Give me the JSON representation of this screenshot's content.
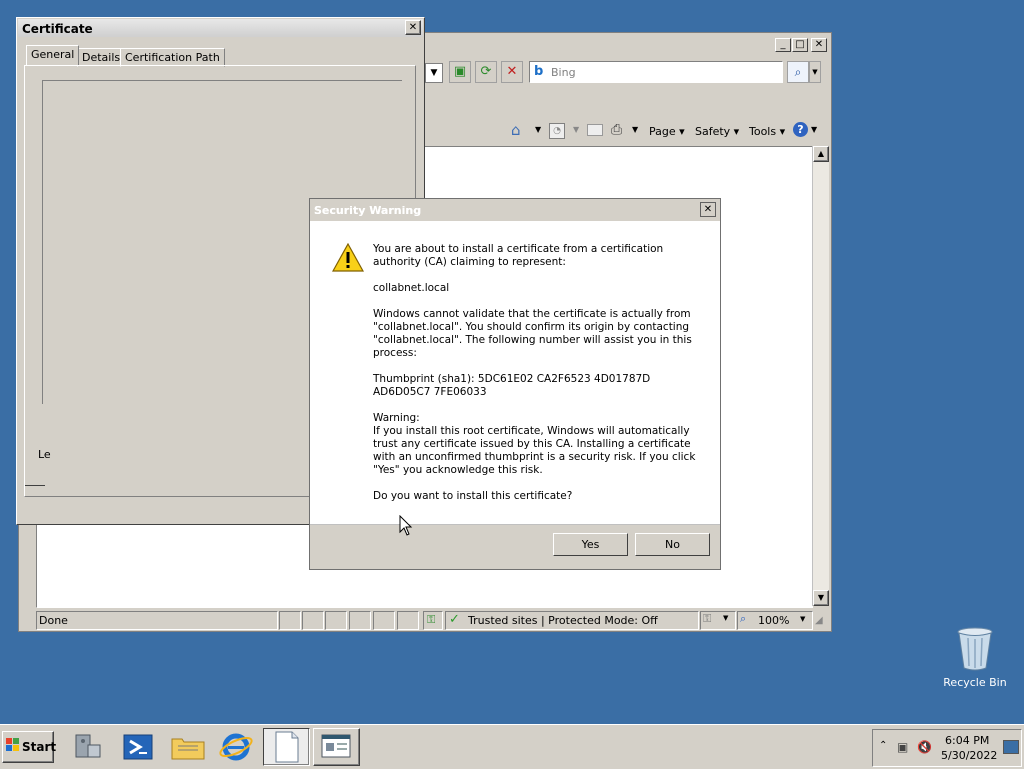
{
  "ie": {
    "search_placeholder": "Bing",
    "command_page": "Page",
    "command_safety": "Safety",
    "command_tools": "Tools",
    "status_text": "Done",
    "zone_text": "Trusted sites | Protected Mode: Off",
    "zoom_text": "100%"
  },
  "cert": {
    "title": "Certificate",
    "tabs": [
      "General",
      "Details",
      "Certification Path"
    ],
    "clipped_label": "Le"
  },
  "security_warning": {
    "title": "Security Warning",
    "line1": "You are about to install a certificate from a certification authority (CA) claiming to represent:",
    "subject": "collabnet.local",
    "line2": "Windows cannot validate that the certificate is actually from \"collabnet.local\". You should confirm its origin by contacting \"collabnet.local\". The following number will assist you in this process:",
    "thumbprint": "Thumbprint (sha1): 5DC61E02 CA2F6523 4D01787D AD6D05C7 7FE06033",
    "warning_label": "Warning:",
    "warning_text": "If you install this root certificate, Windows will automatically trust any certificate issued by this CA. Installing a certificate with an unconfirmed thumbprint is a security risk. If you click \"Yes\" you acknowledge this risk.",
    "question": "Do you want to install this certificate?",
    "yes_label": "Yes",
    "no_label": "No"
  },
  "desktop": {
    "recycle_bin_label": "Recycle Bin"
  },
  "taskbar": {
    "start_label": "Start",
    "time": "6:04 PM",
    "date": "5/30/2022"
  }
}
